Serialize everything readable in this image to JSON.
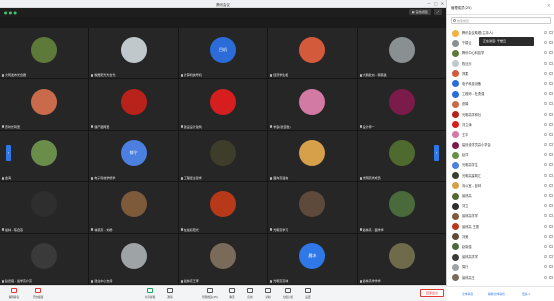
{
  "window": {
    "title": "腾讯会议",
    "min": "—",
    "max": "□",
    "close": "✕"
  },
  "meetbar": {
    "info": "● ● ●",
    "layout_label": "演讲者视图",
    "grid_label": "▦ 宫格视图",
    "fullscreen": "⤢"
  },
  "tiles": [
    {
      "name": "大阿发布光合器",
      "color": "#5d7a3a"
    },
    {
      "name": "晚霞阳光光合光",
      "color": "#c0c8cc"
    },
    {
      "name": "计算机信号机",
      "color": "#2b6cd8",
      "initials": "目机"
    },
    {
      "name": "经济学生和",
      "color": "#d35a3a"
    },
    {
      "name": "大鹅欧洲 - 韩韩鑫",
      "color": "#8a8f92"
    },
    {
      "name": "历时长阿里",
      "color": "#c96b4b"
    },
    {
      "name": "僵尸图阿里",
      "color": "#b8221a"
    },
    {
      "name": "建设设计建筑",
      "color": "#d61e1e"
    },
    {
      "name": "学霸(张百胜)",
      "color": "#d27aa4"
    },
    {
      "name": "设计师一",
      "color": "#7b1b4a"
    },
    {
      "name": "金海",
      "color": "#6a8d4a"
    },
    {
      "name": "电子科技学修学",
      "color": "#4b7fe0",
      "initials": "郁宁"
    },
    {
      "name": "工程经主建学",
      "color": "#3d3d2a"
    },
    {
      "name": "面向高语言",
      "color": "#d6a04a"
    },
    {
      "name": "光明高学成员",
      "color": "#4e6a2e"
    },
    {
      "name": "最林 - 陈自燕",
      "color": "#2e2e2e"
    },
    {
      "name": "林源高 - 刘杨",
      "color": "#7c5a3a"
    },
    {
      "name": "在最初阳光",
      "color": "#b8381a"
    },
    {
      "name": "光明高学习",
      "color": "#5e4a3a"
    },
    {
      "name": "最林高 - 面学学",
      "color": "#4b6a3b"
    },
    {
      "name": "赵德强 - 最学高户高",
      "color": "#3a3a3a"
    },
    {
      "name": "建业中心支持",
      "color": "#9ea4a6"
    },
    {
      "name": "最林高王李",
      "color": "#7a6a5a"
    },
    {
      "name": "光明高高林",
      "color": "#2f78e8",
      "initials": "晨冰"
    },
    {
      "name": "最林高学学学",
      "color": "#6f6a4a"
    }
  ],
  "toolbar": {
    "items": [
      {
        "label": "解除静音"
      },
      {
        "label": "开启视频"
      },
      {
        "label": "共享屏幕"
      },
      {
        "label": "邀请"
      },
      {
        "label": "管理成员(25)"
      },
      {
        "label": "聊天"
      },
      {
        "label": "应用"
      },
      {
        "label": "录制"
      },
      {
        "label": "分组讨论"
      },
      {
        "label": "设置"
      }
    ],
    "end_label": "结束会议"
  },
  "panel": {
    "title": "管理成员(25)",
    "search_placeholder": "搜索成员",
    "tooltip": "正在讲话: 千楼云",
    "participants": [
      {
        "name": "腾讯会议助理(主持人)",
        "color": "#f2b33d"
      },
      {
        "name": "千楼云",
        "color": "#8a8f92"
      },
      {
        "name": "腾讯中心科技学",
        "color": "#5d7a3a"
      },
      {
        "name": "陈丝乐",
        "color": "#c0c8cc"
      },
      {
        "name": "郑柔",
        "color": "#d35a3a"
      },
      {
        "name": "电子科技设备",
        "color": "#2b6cd8"
      },
      {
        "name": "工程师 - 杜勇强",
        "color": "#2b6cd8"
      },
      {
        "name": "张娟",
        "color": "#c96b4b"
      },
      {
        "name": "光明高学和社",
        "color": "#b8221a"
      },
      {
        "name": "刘立涛",
        "color": "#d61e1e"
      },
      {
        "name": "王平",
        "color": "#d27aa4"
      },
      {
        "name": "建设设学员高小学会",
        "color": "#7b1b4a"
      },
      {
        "name": "赵洋",
        "color": "#6a8d4a"
      },
      {
        "name": "光明高学生",
        "color": "#4b7fe0"
      },
      {
        "name": "光明高建筑汇",
        "color": "#3d3d2a"
      },
      {
        "name": "向公室 - 彭林",
        "color": "#d6a04a"
      },
      {
        "name": "最林高",
        "color": "#4e6a2e"
      },
      {
        "name": "刘立",
        "color": "#2e2e2e"
      },
      {
        "name": "最林高学学",
        "color": "#7c5a3a"
      },
      {
        "name": "最林高 王丽",
        "color": "#b8381a"
      },
      {
        "name": "刘美",
        "color": "#5e4a3a"
      },
      {
        "name": "赵晓强",
        "color": "#4b6a3b"
      },
      {
        "name": "最林高学学",
        "color": "#3a3a3a"
      },
      {
        "name": "周行",
        "color": "#9ea4a6"
      },
      {
        "name": "最林高王",
        "color": "#7a6a5a"
      }
    ],
    "footer": {
      "mute_all": "全体静音",
      "unmute_all": "解除全体静音",
      "more": "更多 ▾"
    }
  }
}
